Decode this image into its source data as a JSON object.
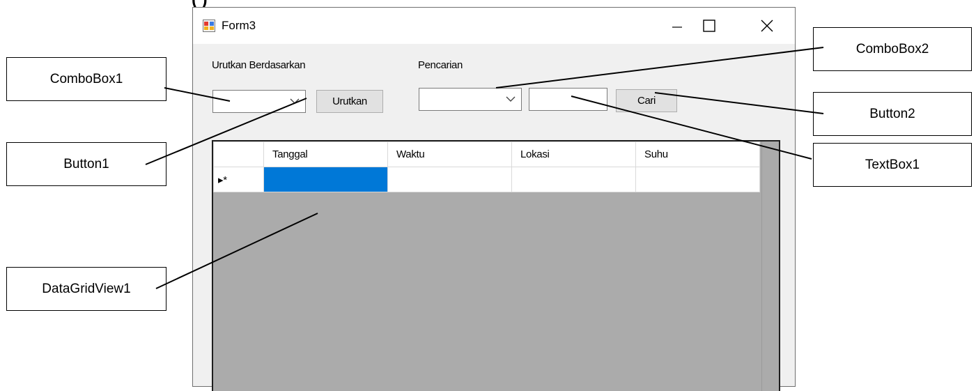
{
  "window": {
    "title": "Form3"
  },
  "sort_section": {
    "label": "Urutkan Berdasarkan",
    "combo_value": "",
    "button_label": "Urutkan"
  },
  "search_section": {
    "label": "Pencarian",
    "combo_value": "",
    "text_value": "",
    "button_label": "Cari"
  },
  "grid": {
    "columns": [
      "Tanggal",
      "Waktu",
      "Lokasi",
      "Suhu"
    ],
    "new_row_marker": "▸*",
    "selection_color": "#0078d7",
    "background_color": "#ababab"
  },
  "callouts": {
    "combobox1": "ComboBox1",
    "button1": "Button1",
    "datagridview1": "DataGridView1",
    "combobox2": "ComboBox2",
    "button2": "Button2",
    "textbox1": "TextBox1"
  }
}
